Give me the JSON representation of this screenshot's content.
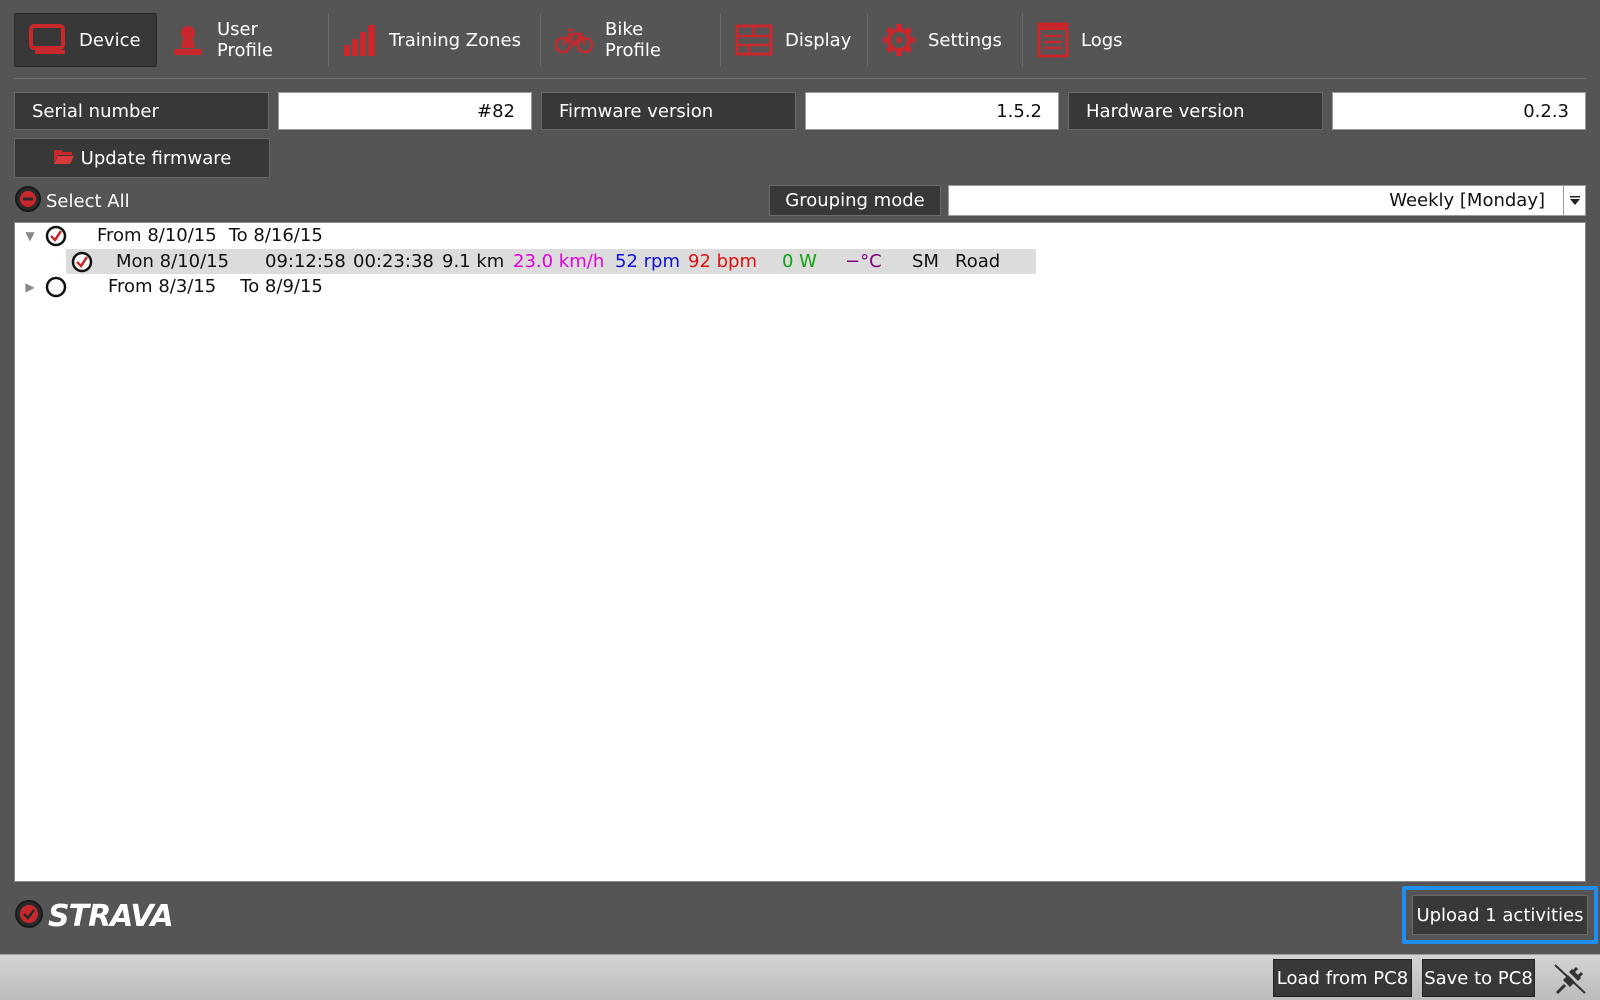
{
  "tabs": [
    {
      "label": "Device",
      "icon": "monitor-icon",
      "active": true
    },
    {
      "label": "User Profile",
      "icon": "user-icon",
      "active": false
    },
    {
      "label": "Training Zones",
      "icon": "bar-chart-icon",
      "active": false
    },
    {
      "label": "Bike Profile",
      "icon": "bike-icon",
      "active": false
    },
    {
      "label": "Display",
      "icon": "display-grid-icon",
      "active": false
    },
    {
      "label": "Settings",
      "icon": "gear-icon",
      "active": false
    },
    {
      "label": "Logs",
      "icon": "log-sheet-icon",
      "active": false
    }
  ],
  "device": {
    "serial_label": "Serial number",
    "serial_value": "#82",
    "firmware_label": "Firmware version",
    "firmware_value": "1.5.2",
    "hardware_label": "Hardware version",
    "hardware_value": "0.2.3",
    "update_firmware_label": "Update firmware"
  },
  "list_controls": {
    "select_all_label": "Select All",
    "grouping_label": "Grouping mode",
    "grouping_value": "Weekly [Monday]"
  },
  "activity_groups": [
    {
      "from": "From 8/10/15",
      "to": "To 8/16/15",
      "expanded": true,
      "checked": true,
      "activities": [
        {
          "date": "Mon 8/10/15",
          "time": "09:12:58",
          "duration": "00:23:38",
          "distance": "9.1 km",
          "speed": "23.0 km/h",
          "cadence": "52 rpm",
          "heart_rate": "92 bpm",
          "power": "0 W",
          "temperature": "−°C",
          "type_code": "SM",
          "bike": "Road",
          "checked": true
        }
      ]
    },
    {
      "from": "From 8/3/15",
      "to": "To 8/9/15",
      "expanded": false,
      "checked": false,
      "activities": []
    }
  ],
  "colors": {
    "speed": "#e000e0",
    "cadence": "#1010d8",
    "heart_rate": "#e01010",
    "power": "#10a010",
    "temperature": "#800080",
    "accent_red": "#c8282c",
    "highlight_blue": "#1e8ff0"
  },
  "strava": {
    "logo_text": "STRAVA",
    "upload_label": "Upload 1 activities"
  },
  "statusbar": {
    "load_label": "Load from PC8",
    "save_label": "Save to PC8",
    "connection_icon": "plug-disconnected-icon"
  }
}
